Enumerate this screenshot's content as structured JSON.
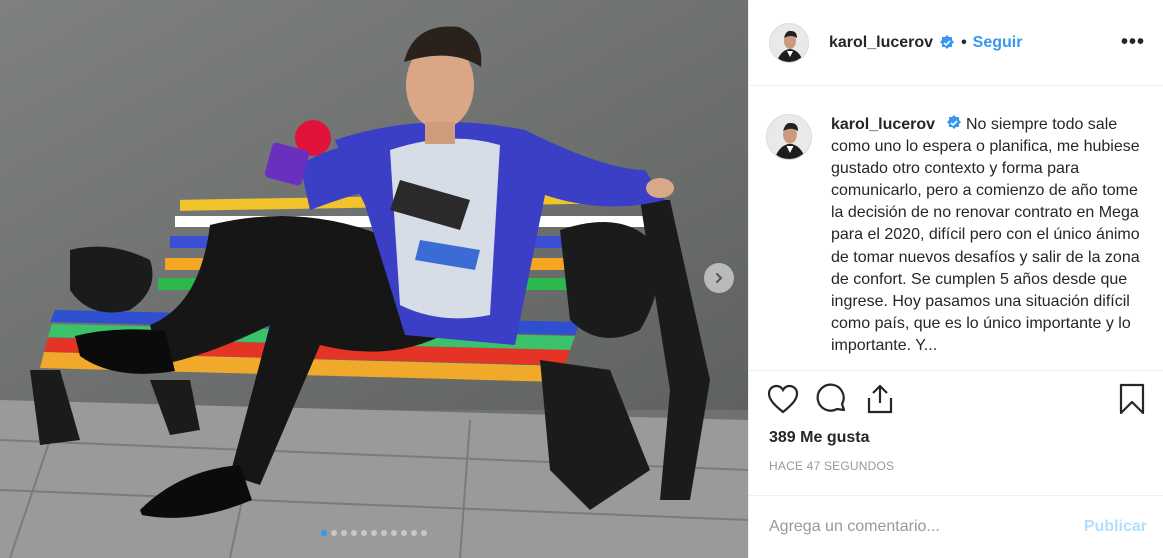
{
  "header": {
    "username": "karol_lucerov",
    "separator": "•",
    "follow_label": "Seguir",
    "more_label": "•••",
    "avatar": "profile-avatar"
  },
  "caption": {
    "username": "karol_lucerov",
    "text": "No siempre todo sale como uno lo espera o planifica, me hubiese gustado otro contexto y forma para comunicarlo, pero a comienzo de año tome la decisión de no renovar contrato en Mega para el 2020, difícil pero con el único ánimo de tomar nuevos desafíos y salir de la zona de confort. Se cumplen 5 años desde que ingrese. Hoy pasamos una situación difícil como país, que es lo único importante y lo importante. Y..."
  },
  "actions": {
    "like_icon": "heart-icon",
    "comment_icon": "comment-icon",
    "share_icon": "share-icon",
    "save_icon": "bookmark-icon"
  },
  "likes_text": "389 Me gusta",
  "timestamp": "HACE 47 SEGUNDOS",
  "comment": {
    "placeholder": "Agrega un comentario...",
    "publish_label": "Publicar"
  },
  "carousel": {
    "slides": 11,
    "active_index": 0
  },
  "colors": {
    "accent": "#3897f0",
    "publish_disabled": "#b2dffc",
    "muted": "#999999",
    "text": "#262626"
  }
}
